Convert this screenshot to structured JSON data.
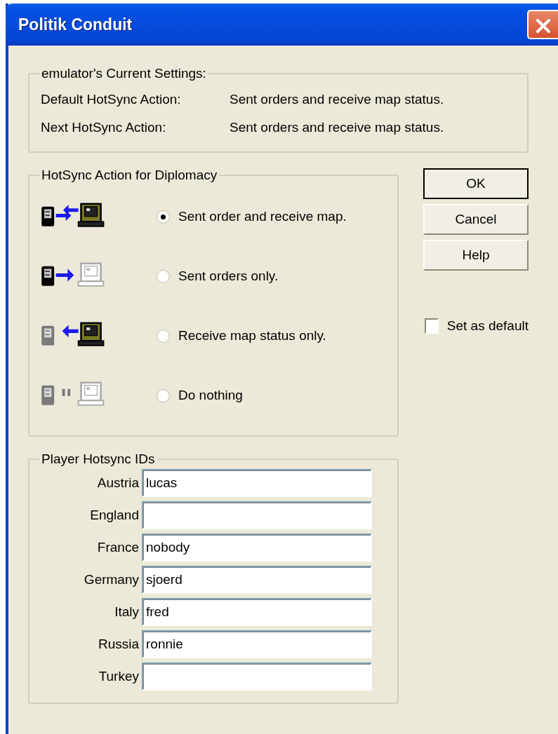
{
  "window": {
    "title": "Politik Conduit"
  },
  "current_settings": {
    "title": "emulator's Current Settings:",
    "rows": [
      {
        "label": "Default HotSync Action:",
        "value": "Sent orders and receive map status."
      },
      {
        "label": "Next HotSync Action:",
        "value": "Sent orders and receive map status."
      }
    ]
  },
  "hotsync_action": {
    "title": "HotSync Action for Diplomacy",
    "options": [
      {
        "kind": "both",
        "label": "Sent order and receive map.",
        "selected": true
      },
      {
        "kind": "send",
        "label": "Sent orders only.",
        "selected": false
      },
      {
        "kind": "receive",
        "label": "Receive map status only.",
        "selected": false
      },
      {
        "kind": "none",
        "label": "Do nothing",
        "selected": false
      }
    ]
  },
  "player_ids": {
    "title": "Player Hotsync IDs",
    "rows": [
      {
        "label": "Austria",
        "value": "lucas"
      },
      {
        "label": "England"
      },
      {
        "label": "France",
        "value": "nobody"
      },
      {
        "label": "Germany",
        "value": "sjoerd"
      },
      {
        "label": "Italy",
        "value": "fred"
      },
      {
        "label": "Russia",
        "value": "ronnie"
      },
      {
        "label": "Turkey"
      }
    ]
  },
  "buttons": [
    {
      "label": "OK",
      "default": true
    },
    {
      "label": "Cancel",
      "default": false
    },
    {
      "label": "Help",
      "default": false
    }
  ],
  "set_as_default": {
    "label": "Set as default",
    "checked": false
  }
}
